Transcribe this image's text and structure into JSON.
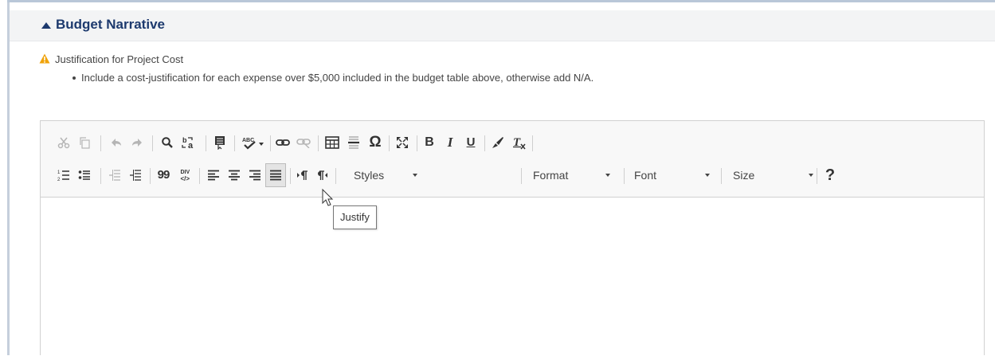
{
  "section": {
    "title": "Budget Narrative",
    "collapse_icon": "triangle-up-icon"
  },
  "question": {
    "warning_icon": "warning-triangle-icon",
    "label": "Justification for Project Cost",
    "instruction": "Include a cost-justification for each expense over $5,000 included in the budget table above, otherwise add N/A."
  },
  "editor": {
    "toolbar": {
      "row1": [
        "cut-icon",
        "copy-icon",
        "undo-icon",
        "redo-icon",
        "find-icon",
        "replace-icon",
        "select-all-icon",
        "spellcheck-icon",
        "link-icon",
        "unlink-icon",
        "table-icon",
        "horizontal-line-icon",
        "special-char-icon",
        "maximize-icon",
        "bold-icon",
        "italic-icon",
        "underline-icon",
        "copy-format-icon",
        "remove-format-icon"
      ],
      "row2": [
        "numbered-list-icon",
        "bulleted-list-icon",
        "decrease-indent-icon",
        "increase-indent-icon",
        "blockquote-icon",
        "create-div-icon",
        "align-left-icon",
        "align-center-icon",
        "align-right-icon",
        "justify-icon",
        "ltr-icon",
        "rtl-icon"
      ],
      "dropdowns": {
        "styles": "Styles",
        "format": "Format",
        "font": "Font",
        "size": "Size"
      },
      "help_label": "?",
      "text_icons": {
        "bold": "B",
        "italic": "I",
        "underline": "U",
        "omega": "Ω",
        "quote": "99"
      }
    },
    "tooltip": "Justify",
    "content": ""
  },
  "colors": {
    "title": "#1d3a6e",
    "warning": "#f0a30a",
    "icon": "#333333",
    "icon_disabled": "#b5b5b5"
  }
}
